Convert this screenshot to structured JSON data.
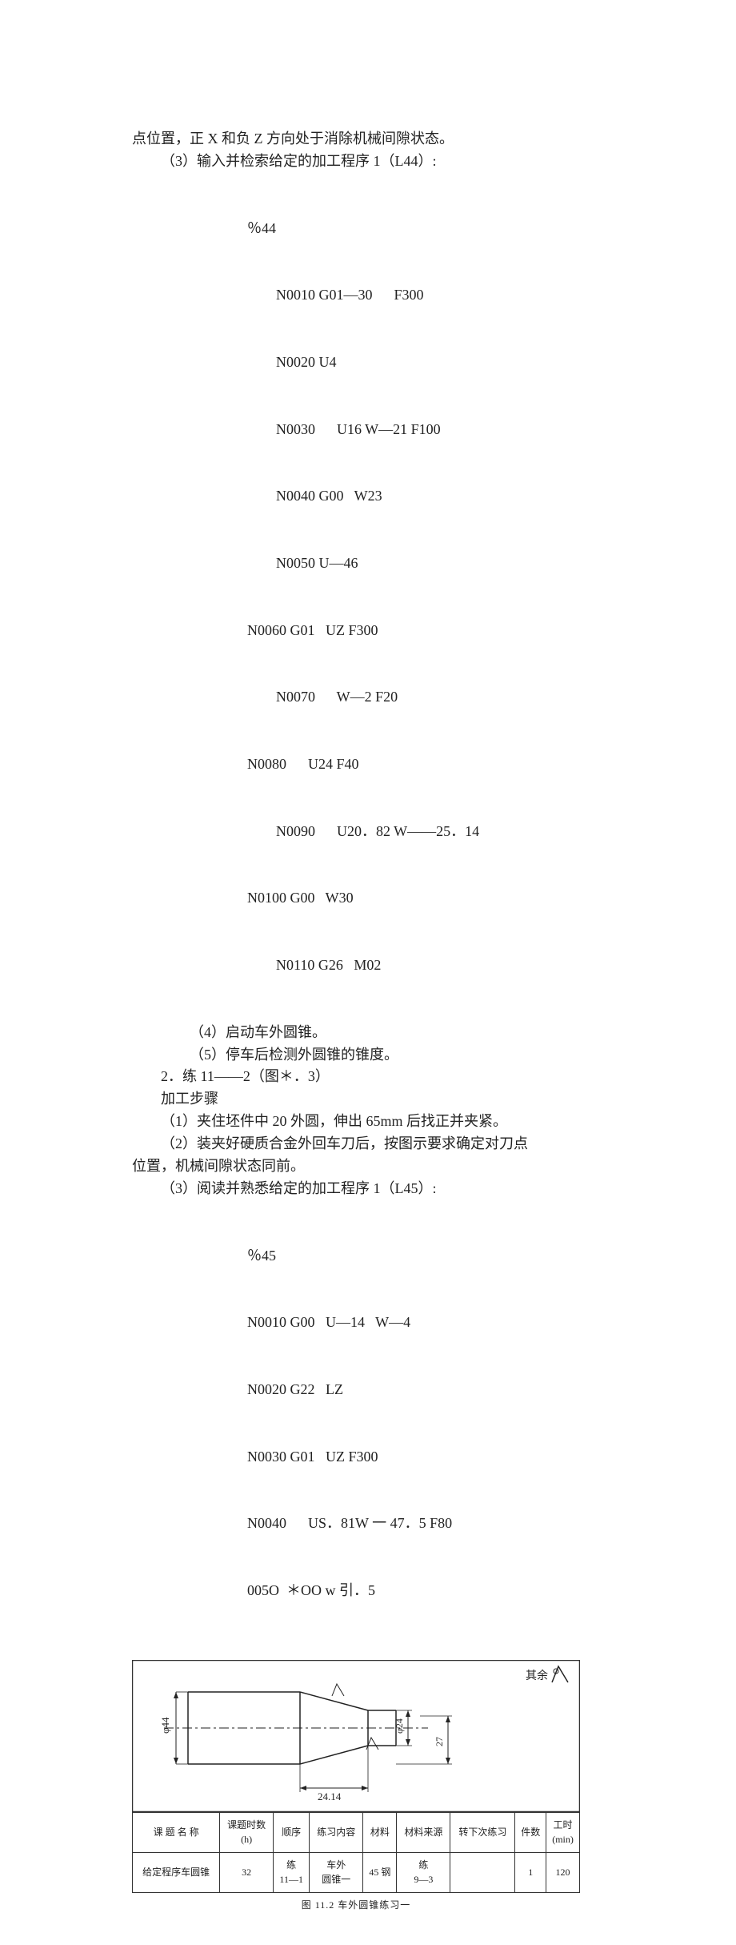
{
  "body": {
    "line1": "点位置，正 X 和负 Z 方向处于消除机械间隙状态。",
    "line2": "（3）输入并检索给定的加工程序 1（L44）:",
    "code44_header": "％44",
    "code44": [
      "N0010 G01—30      F300",
      "N0020 U4",
      "N0030      U16 W—21 F100",
      "N0040 G00   W23",
      "N0050 U—46",
      "N0060 G01   UZ F300",
      "N0070      W—2 F20",
      "N0080      U24 F40",
      "N0090      U20．82 W——25．14",
      "N0100 G00   W30",
      "N0110 G26   M02"
    ],
    "indents44": [
      "c1",
      "c1",
      "c1",
      "c1",
      "c1",
      "c0",
      "c1",
      "c0",
      "c1",
      "c0",
      "c1"
    ],
    "line3": "（4）启动车外圆锥。",
    "line4": "（5）停车后检测外圆锥的锥度。",
    "line5": "2．练 11——2（图＊．3）",
    "line6": "加工步骤",
    "line7": "（1）夹住坯件中 20 外圆，伸出    65mm 后找正并夹紧。",
    "line8a": "（2）装夹好硬质合金外回车刀后，按图示要求确定对刀点",
    "line8b": "位置，机械间隙状态同前。",
    "line9": "（3）阅读并熟悉给定的加工程序 1（L45）:",
    "code45_header": "％45",
    "code45": [
      "N0010 G00   U—14   W—4",
      "N0020 G22   LZ",
      "N0030 G01   UZ F300",
      "N0040      US．81W 一 47．5 F80",
      "005O  ＊OO w 引．5"
    ]
  },
  "figure": {
    "top_label": "其余",
    "phi44": "φ44",
    "phi24": "φ24",
    "h27": "27",
    "w24_14": "24.14",
    "ra_small": "",
    "caption": "图 11.2  车外圆锥练习一"
  },
  "table": {
    "headers": [
      "课 题 名 称",
      "课题时数\n(h)",
      "顺序",
      "练习内容",
      "材料",
      "材料来源",
      "转下次练习",
      "件数",
      "工时\n(min)"
    ],
    "row": [
      "给定程序车圆锥",
      "32",
      "练\n11—1",
      "车外\n圆锥一",
      "45 钢",
      "练\n9—3",
      "",
      "1",
      "120"
    ]
  }
}
